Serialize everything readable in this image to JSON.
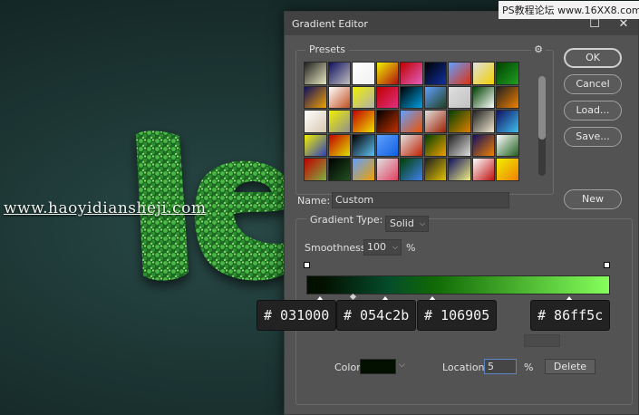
{
  "watermark": "www.haoyidiansheji.com",
  "badge": "PS教程论坛 www.16XX8.com",
  "dialog": {
    "title": "Gradient Editor",
    "window_controls": {
      "minimize": "—",
      "maximize": "☐",
      "close": "✕"
    },
    "presets_label": "Presets",
    "gear_icon": "⚙",
    "buttons": {
      "ok": "OK",
      "cancel": "Cancel",
      "load": "Load...",
      "save": "Save...",
      "new": "New",
      "delete": "Delete"
    },
    "name_label": "Name:",
    "name_value": "Custom",
    "gradient_type_label": "Gradient Type:",
    "gradient_type_value": "Solid",
    "smoothness_label": "Smoothness:",
    "smoothness_value": "100",
    "percent": "%",
    "color_label": "Color:",
    "location_label": "Location:",
    "location_value": "5",
    "dropdown_arrow": "⌵"
  },
  "hex_tags": [
    "# 031000",
    "# 054c2b",
    "# 106905",
    "# 86ff5c"
  ],
  "presets": [
    [
      "#e8e8c0",
      "#c0c0c0",
      "#f0f0f0",
      "#b01010",
      "#e060c0",
      "#1030a0",
      "#e03010",
      "#f0d000",
      "#20a020"
    ],
    [
      "#f0a000",
      "#c05020",
      "#b0b0b0",
      "#e03080",
      "#00a0e0",
      "#204020",
      "#c0c0c0",
      "#ffffff",
      "#f08000"
    ],
    [
      "#d8c8b0",
      "#909090",
      "#f0e000",
      "#c03000",
      "#f05000",
      "#a02000",
      "#e08000",
      "#f0e8d0",
      "#40c0f0"
    ],
    [
      "#3040c0",
      "#e0e000",
      "#60c0f0",
      "#1060e0",
      "#c02000",
      "#f0a000",
      "#e0e0e0",
      "#f08000",
      "#206020"
    ],
    [
      "#80b040",
      "#205020",
      "#f0a000",
      "#e04060",
      "#4080f0",
      "#e0c000",
      "#f0f080",
      "#c01010",
      "#f08000"
    ]
  ],
  "colors": {
    "stop1": "#031000",
    "stop2": "#054c2b",
    "stop3": "#106905",
    "stop4": "#86ff5c"
  }
}
